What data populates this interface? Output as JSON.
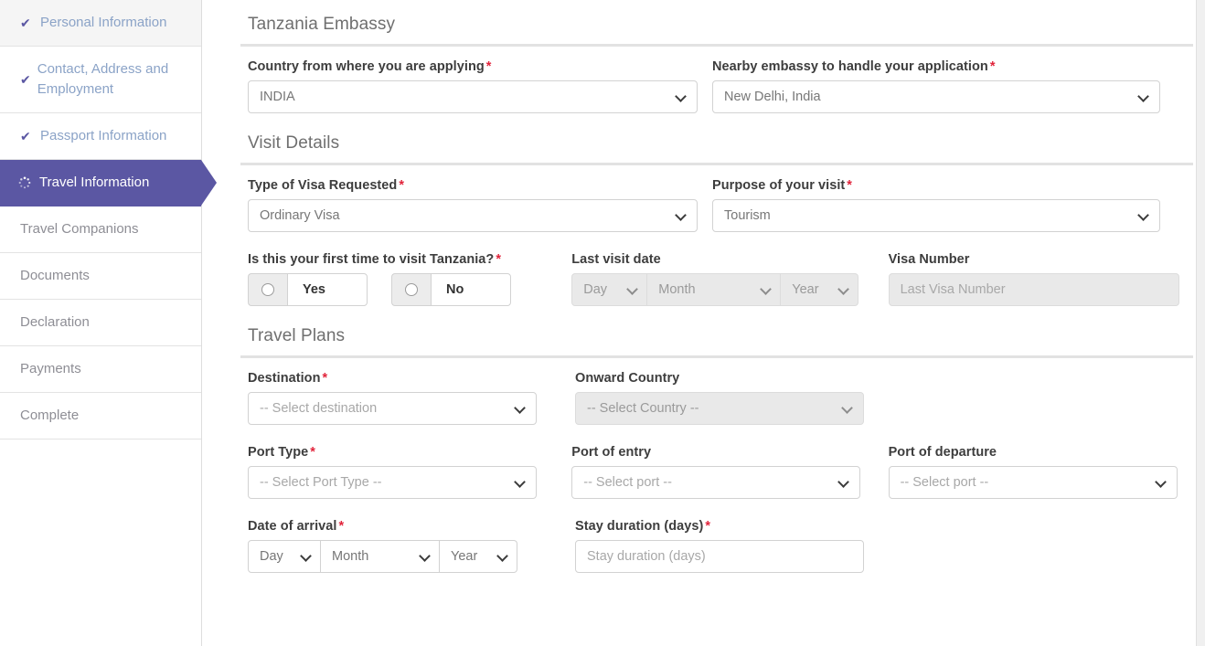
{
  "sidebar": {
    "items": [
      {
        "label": "Personal Information",
        "state": "done",
        "icon": "check-icon",
        "highlight": true
      },
      {
        "label": "Contact, Address and Employment",
        "state": "done",
        "icon": "check-icon",
        "highlight": false
      },
      {
        "label": "Passport Information",
        "state": "done",
        "icon": "check-icon",
        "highlight": false
      },
      {
        "label": "Travel Information",
        "state": "active",
        "icon": "spinner-icon",
        "highlight": false
      },
      {
        "label": "Travel Companions",
        "state": "pending",
        "icon": "",
        "highlight": false
      },
      {
        "label": "Documents",
        "state": "pending",
        "icon": "",
        "highlight": false
      },
      {
        "label": "Declaration",
        "state": "pending",
        "icon": "",
        "highlight": false
      },
      {
        "label": "Payments",
        "state": "pending",
        "icon": "",
        "highlight": false
      },
      {
        "label": "Complete",
        "state": "pending",
        "icon": "",
        "highlight": false
      }
    ]
  },
  "colors": {
    "active_step": "#5b57a3",
    "done_step_text": "#8ba3c7",
    "required_asterisk": "#e1243b",
    "section_title": "#6f6f6f"
  },
  "sections": {
    "embassy": {
      "title": "Tanzania Embassy",
      "country_label": "Country from where you are applying",
      "country_required": "*",
      "country_value": "INDIA",
      "embassy_label": "Nearby embassy to handle your application",
      "embassy_required": "*",
      "embassy_value": "New Delhi, India"
    },
    "visit": {
      "title": "Visit Details",
      "visa_type_label": "Type of Visa Requested",
      "visa_type_required": "*",
      "visa_type_value": "Ordinary Visa",
      "purpose_label": "Purpose of your visit",
      "purpose_required": "*",
      "purpose_value": "Tourism",
      "first_time_label": "Is this your first time to visit Tanzania?",
      "first_time_required": "*",
      "first_time_yes": "Yes",
      "first_time_no": "No",
      "last_visit_label": "Last visit date",
      "last_visit_day": "Day",
      "last_visit_month": "Month",
      "last_visit_year": "Year",
      "visa_number_label": "Visa Number",
      "visa_number_placeholder": "Last Visa Number",
      "visa_number_value": ""
    },
    "plans": {
      "title": "Travel Plans",
      "destination_label": "Destination",
      "destination_required": "*",
      "destination_value": "-- Select destination",
      "onward_label": "Onward Country",
      "onward_value": "-- Select Country --",
      "port_type_label": "Port Type",
      "port_type_required": "*",
      "port_type_value": "-- Select Port Type --",
      "port_entry_label": "Port of entry",
      "port_entry_value": "-- Select port --",
      "port_departure_label": "Port of departure",
      "port_departure_value": "-- Select port --",
      "arrival_label": "Date of arrival",
      "arrival_required": "*",
      "arrival_day": "Day",
      "arrival_month": "Month",
      "arrival_year": "Year",
      "stay_label": "Stay duration (days)",
      "stay_required": "*",
      "stay_placeholder": "Stay duration (days)",
      "stay_value": ""
    }
  }
}
